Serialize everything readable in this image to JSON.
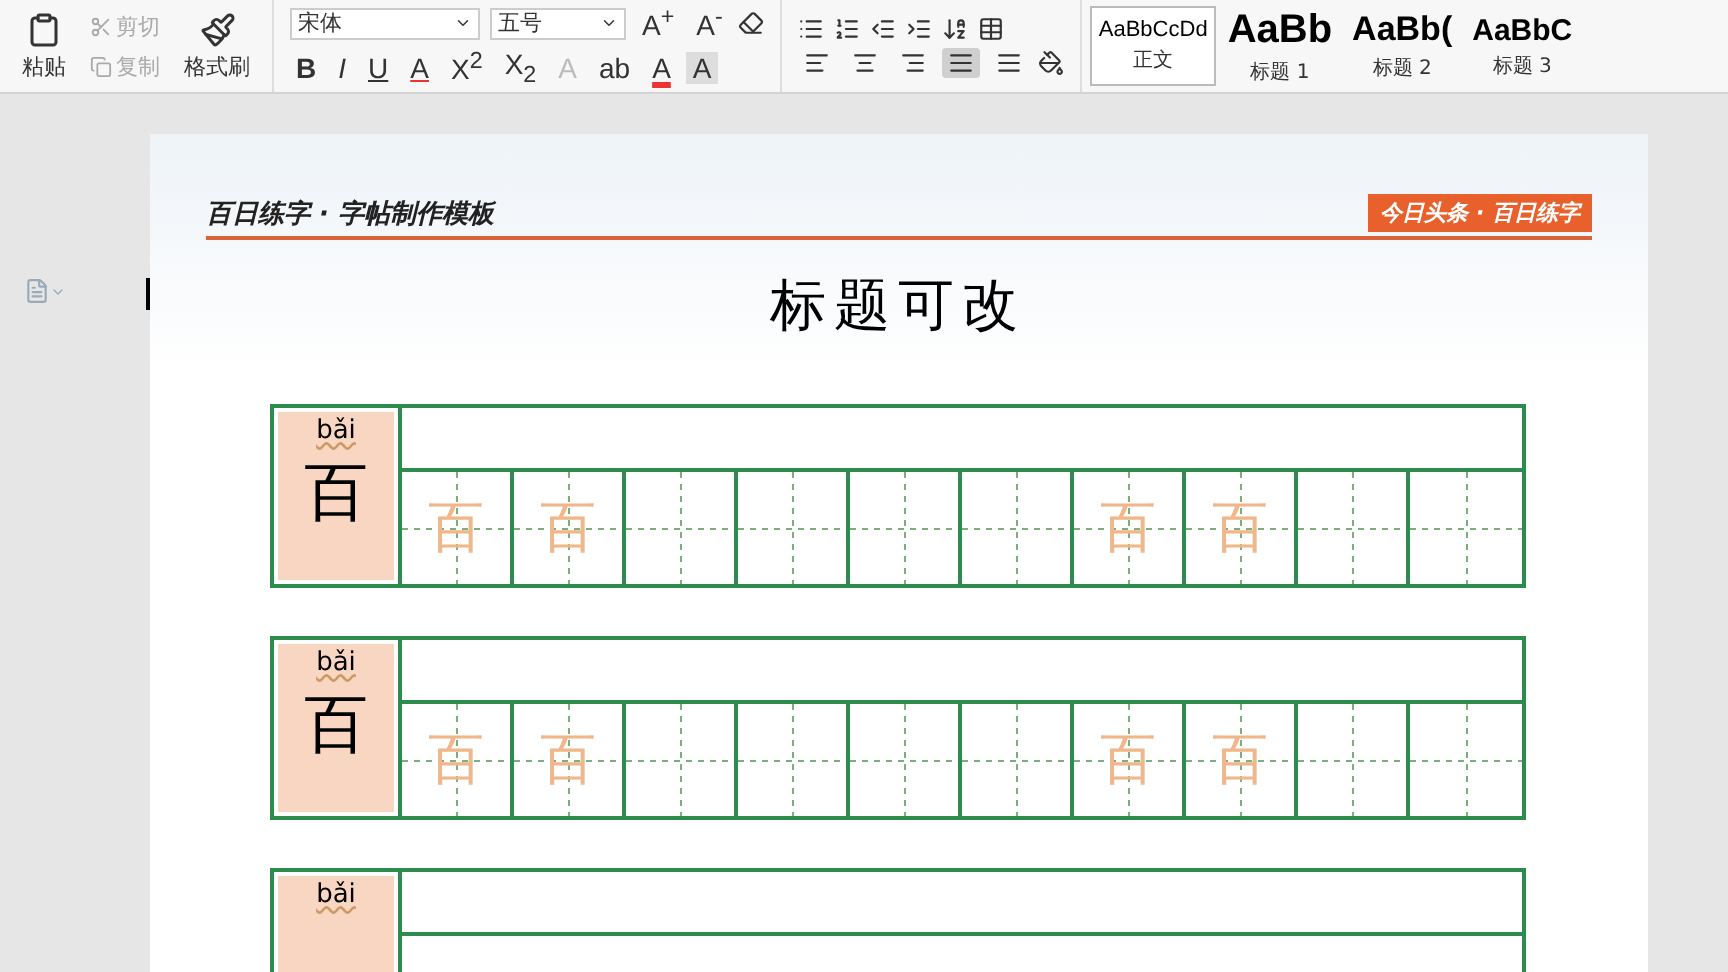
{
  "clipboard": {
    "paste": "粘贴",
    "cut": "剪切",
    "copy": "复制",
    "format_painter": "格式刷"
  },
  "font": {
    "family": "宋体",
    "size": "五号"
  },
  "font_buttons": [
    {
      "label": "A$^{+}$"
    },
    {
      "label": "A$^{-}$"
    }
  ],
  "format_buttons": [
    {
      "label": "B",
      "kind": "bold"
    },
    {
      "label": "I",
      "kind": "italic"
    },
    {
      "label": "U",
      "kind": "underline"
    },
    {
      "label": "A",
      "kind": "strike"
    },
    {
      "label": "X$^{2}$",
      "kind": "plain"
    },
    {
      "label": "X$_{2}$",
      "kind": "plain"
    },
    {
      "label": "A",
      "kind": "outline"
    },
    {
      "label": "ab",
      "kind": "plain"
    },
    {
      "label": "A",
      "kind": "color"
    },
    {
      "label": "A",
      "kind": "shade"
    }
  ],
  "align_buttons": [
    {
      "kind": "left",
      "selected": false
    },
    {
      "kind": "center",
      "selected": false
    },
    {
      "kind": "right",
      "selected": false
    },
    {
      "kind": "justify",
      "selected": true
    },
    {
      "kind": "distribute",
      "selected": false
    }
  ],
  "styles": [
    {
      "preview": "AaBbCcDd",
      "name": "正文",
      "selected": true,
      "kind": "body"
    },
    {
      "preview": "AaBb",
      "name": "标题 1",
      "selected": false,
      "kind": "h1"
    },
    {
      "preview": "AaBb(",
      "name": "标题 2",
      "selected": false,
      "kind": "h2"
    },
    {
      "preview": "AaBbC",
      "name": "标题 3",
      "selected": false,
      "kind": "h3"
    }
  ],
  "page": {
    "header_title": "百日练字 · 字帖制作模板",
    "badge": "今日头条 · 百日练字",
    "title": "标题可改"
  },
  "blocks": [
    {
      "pinyin": "bǎi",
      "char": "百",
      "cells": [
        {
          "kind": "trace",
          "text": "百"
        },
        {
          "kind": "trace",
          "text": "百"
        },
        {
          "kind": "blank"
        },
        {
          "kind": "blank"
        },
        {
          "kind": "blank"
        },
        {
          "kind": "blank"
        },
        {
          "kind": "trace",
          "text": "百"
        },
        {
          "kind": "trace",
          "text": "百"
        },
        {
          "kind": "blank"
        },
        {
          "kind": "blank"
        }
      ]
    },
    {
      "pinyin": "bǎi",
      "char": "百",
      "cells": [
        {
          "kind": "trace",
          "text": "百"
        },
        {
          "kind": "trace",
          "text": "百"
        },
        {
          "kind": "blank"
        },
        {
          "kind": "blank"
        },
        {
          "kind": "blank"
        },
        {
          "kind": "blank"
        },
        {
          "kind": "trace",
          "text": "百"
        },
        {
          "kind": "trace",
          "text": "百"
        },
        {
          "kind": "blank"
        },
        {
          "kind": "blank"
        }
      ]
    },
    {
      "pinyin": "bǎi"
    }
  ]
}
